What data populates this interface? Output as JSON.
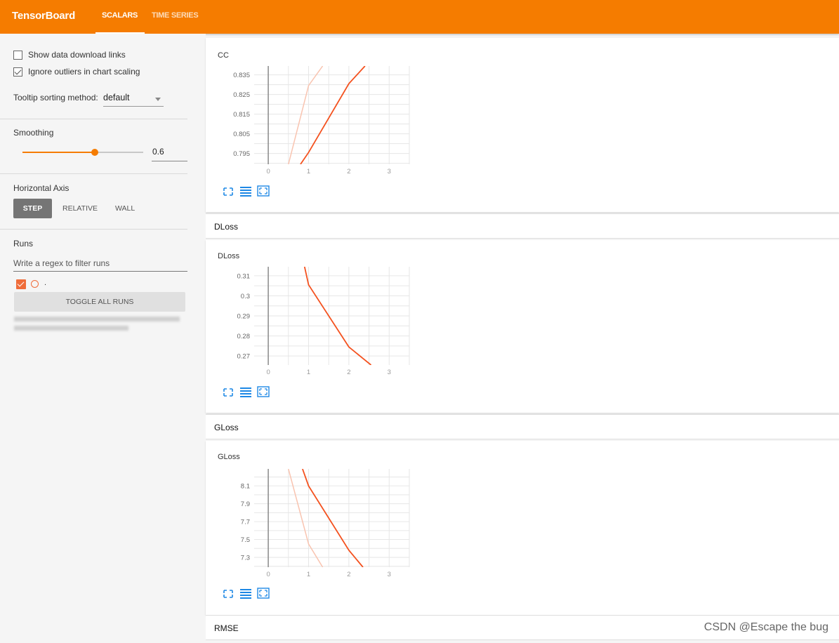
{
  "app": {
    "title": "TensorBoard",
    "tabs": [
      {
        "label": "SCALARS",
        "active": true
      },
      {
        "label": "TIME SERIES",
        "active": false
      }
    ],
    "accent_color": "#f57c00"
  },
  "sidebar": {
    "show_download_links": {
      "label": "Show data download links",
      "checked": false
    },
    "ignore_outliers": {
      "label": "Ignore outliers in chart scaling",
      "checked": true
    },
    "tooltip_sorting": {
      "label": "Tooltip sorting method:",
      "value": "default"
    },
    "smoothing": {
      "label": "Smoothing",
      "value": "0.6",
      "fraction": 0.6
    },
    "horizontal_axis": {
      "label": "Horizontal Axis",
      "options": [
        "STEP",
        "RELATIVE",
        "WALL"
      ],
      "selected": "STEP"
    },
    "runs": {
      "label": "Runs",
      "filter_placeholder": "Write a regex to filter runs",
      "run_label": ".",
      "run_color": "#ef6c3a",
      "toggle_label": "TOGGLE ALL RUNS"
    }
  },
  "main": {
    "categories": [
      "DLoss",
      "GLoss",
      "RMSE"
    ]
  },
  "chart_data": [
    {
      "type": "line",
      "title": "CC",
      "xlim": [
        -0.35,
        3.5
      ],
      "ylim": [
        0.7895,
        0.8395
      ],
      "xticks": [
        0,
        1,
        2,
        3
      ],
      "yticks": [
        0.795,
        0.805,
        0.815,
        0.825,
        0.835
      ],
      "ytick_labels": [
        "0.795",
        "0.805",
        "0.815",
        "0.825",
        "0.835"
      ],
      "series": [
        {
          "role": "smoothed",
          "color": "#f4511e",
          "x": [
            0.8,
            1,
            2,
            2.4
          ],
          "y": [
            0.7895,
            0.7955,
            0.8305,
            0.8395
          ]
        },
        {
          "role": "raw",
          "color": "#f9c4b0",
          "x": [
            0.5,
            1,
            1.35
          ],
          "y": [
            0.7895,
            0.8295,
            0.8395
          ]
        }
      ],
      "grid": true
    },
    {
      "type": "line",
      "title": "DLoss",
      "xlim": [
        -0.35,
        3.5
      ],
      "ylim": [
        0.2655,
        0.3145
      ],
      "xticks": [
        0,
        1,
        2,
        3
      ],
      "yticks": [
        0.27,
        0.28,
        0.29,
        0.3,
        0.31
      ],
      "ytick_labels": [
        "0.27",
        "0.28",
        "0.29",
        "0.3",
        "0.31"
      ],
      "series": [
        {
          "role": "smoothed",
          "color": "#f4511e",
          "x": [
            0.9,
            1,
            2,
            2.55
          ],
          "y": [
            0.3145,
            0.3055,
            0.2745,
            0.2655
          ]
        }
      ],
      "grid": true
    },
    {
      "type": "line",
      "title": "GLoss",
      "xlim": [
        -0.35,
        3.5
      ],
      "ylim": [
        7.19,
        8.29
      ],
      "xticks": [
        0,
        1,
        2,
        3
      ],
      "yticks": [
        7.3,
        7.5,
        7.7,
        7.9,
        8.1
      ],
      "ytick_labels": [
        "7.3",
        "7.5",
        "7.7",
        "7.9",
        "8.1"
      ],
      "series": [
        {
          "role": "smoothed",
          "color": "#f4511e",
          "x": [
            0.85,
            1,
            2,
            2.35
          ],
          "y": [
            8.29,
            8.1,
            7.38,
            7.19
          ]
        },
        {
          "role": "raw",
          "color": "#f9c4b0",
          "x": [
            0.5,
            1,
            1.35
          ],
          "y": [
            8.29,
            7.45,
            7.19
          ]
        }
      ],
      "grid": true
    }
  ],
  "watermark": "CSDN @Escape the bug"
}
